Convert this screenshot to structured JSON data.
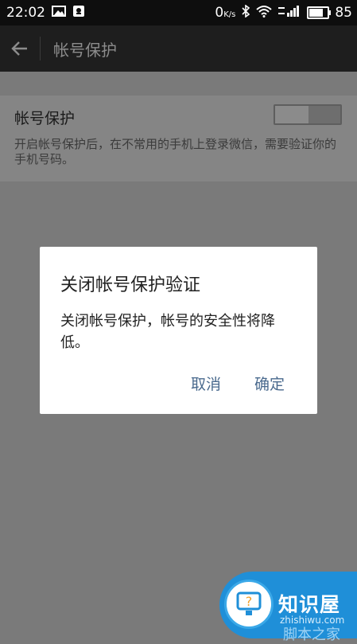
{
  "status_bar": {
    "time": "22:02",
    "network_speed": "0",
    "network_unit": "K/s",
    "battery": "85",
    "battery_level": 0.85,
    "icons": [
      "image-icon",
      "notification-icon",
      "bluetooth-icon",
      "wifi-icon",
      "signal-icon",
      "battery-icon"
    ]
  },
  "toolbar": {
    "back_icon": "back-arrow-icon",
    "title": "帐号保护"
  },
  "setting": {
    "title": "帐号保护",
    "description": "开启帐号保护后，在不常用的手机上登录微信，需要验证你的手机号码。",
    "toggle_state": "on"
  },
  "dialog": {
    "title": "关闭帐号保护验证",
    "message": "关闭帐号保护，帐号的安全性将降低。",
    "cancel_label": "取消",
    "confirm_label": "确定"
  },
  "watermark": {
    "brand": "知识屋",
    "domain": "zhishiwu.com",
    "extra": "脚本之家"
  },
  "colors": {
    "status_bar": "#0e0e0e",
    "scrim": "#7a7a7a",
    "dialog_button": "#4a6a8e",
    "watermark": "#1f8fd8"
  }
}
